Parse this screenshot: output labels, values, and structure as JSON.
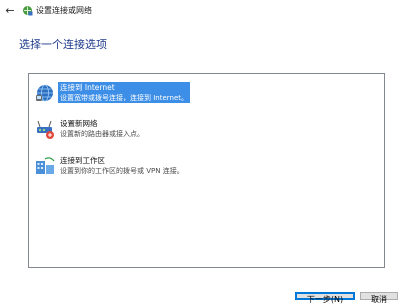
{
  "window": {
    "title": "设置连接或网络"
  },
  "page": {
    "heading": "选择一个连接选项"
  },
  "options": [
    {
      "title": "连接到 Internet",
      "description": "设置宽带或拨号连接，连接到 Internet。",
      "icon": "globe-network-icon",
      "selected": true
    },
    {
      "title": "设置新网络",
      "description": "设置新的路由器或接入点。",
      "icon": "router-icon",
      "selected": false
    },
    {
      "title": "连接到工作区",
      "description": "设置到你的工作区的拨号或 VPN 连接。",
      "icon": "workplace-vpn-icon",
      "selected": false
    }
  ],
  "buttons": {
    "next": "下一步(N)",
    "cancel": "取消"
  },
  "colors": {
    "heading": "#1e3a8c",
    "selection": "#3d8ee6",
    "border": "#828790"
  }
}
